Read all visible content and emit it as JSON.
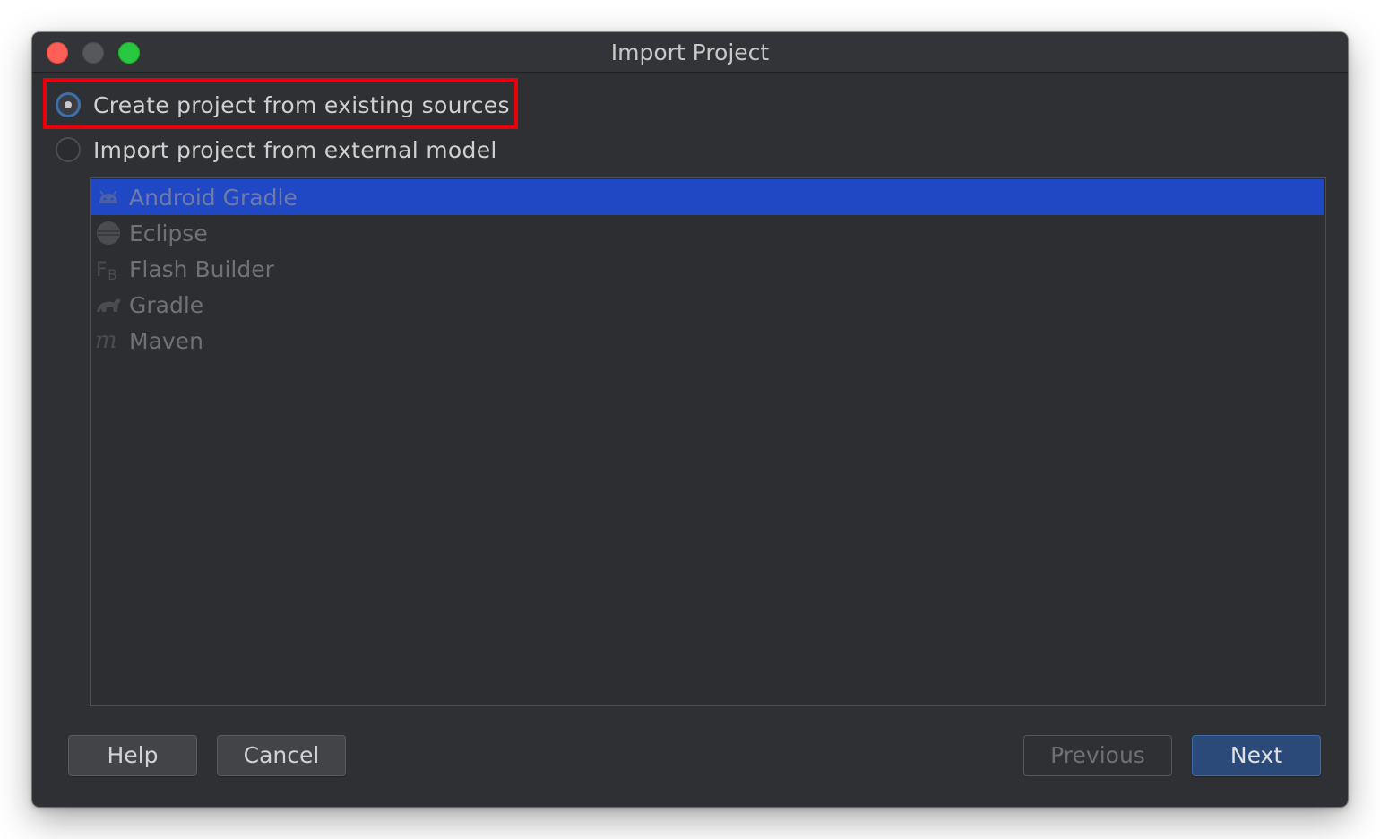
{
  "window": {
    "title": "Import Project"
  },
  "options": [
    {
      "label": "Create project from existing sources",
      "selected": true
    },
    {
      "label": "Import project from external model",
      "selected": false
    }
  ],
  "models": [
    {
      "label": "Android Gradle",
      "icon": "android-icon",
      "selected": true
    },
    {
      "label": "Eclipse",
      "icon": "eclipse-icon",
      "selected": false
    },
    {
      "label": "Flash Builder",
      "icon": "flash-builder-icon",
      "selected": false
    },
    {
      "label": "Gradle",
      "icon": "gradle-icon",
      "selected": false
    },
    {
      "label": "Maven",
      "icon": "maven-icon",
      "selected": false
    }
  ],
  "buttons": {
    "help": "Help",
    "cancel": "Cancel",
    "previous": "Previous",
    "next": "Next"
  },
  "colors": {
    "accent": "#2148c4",
    "highlight_border": "#e8000b",
    "primary_button": "#2b4a7a"
  }
}
